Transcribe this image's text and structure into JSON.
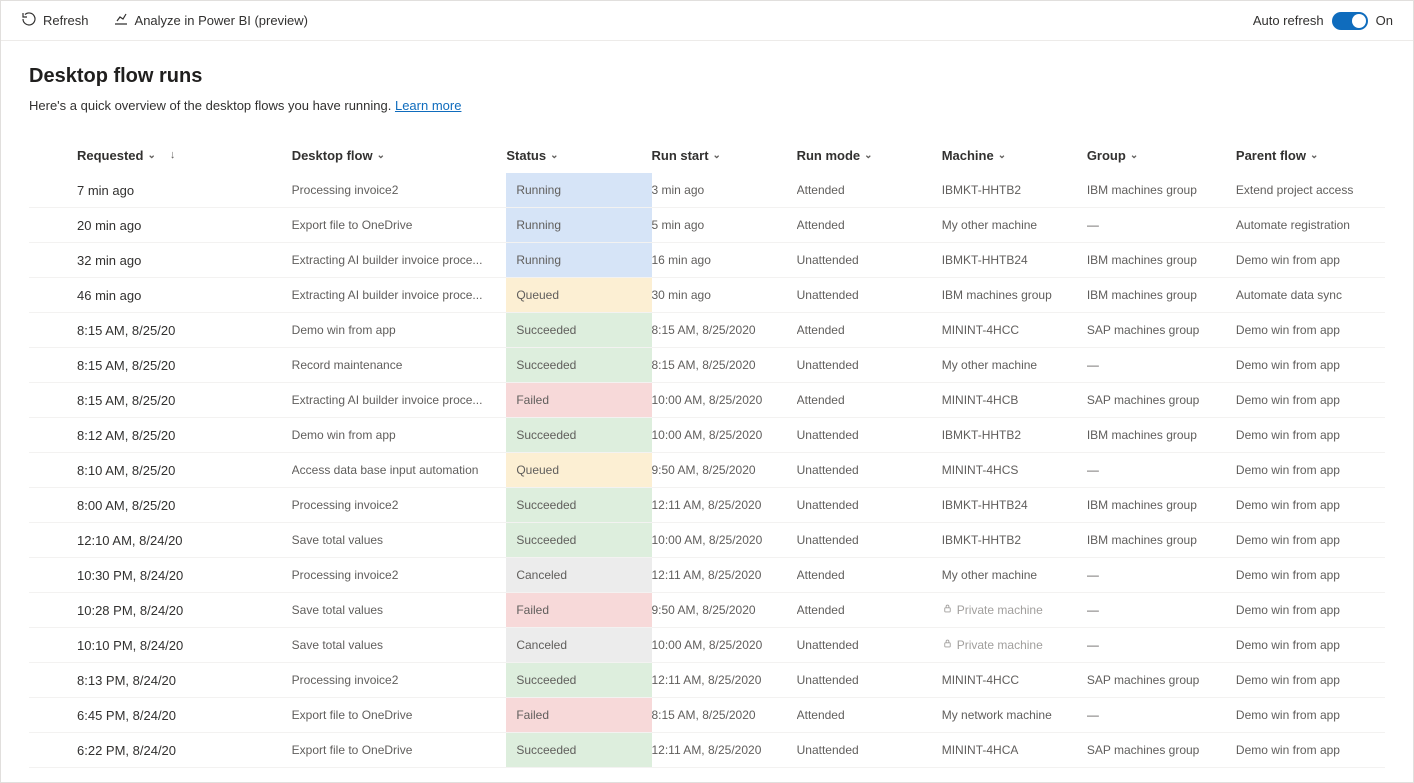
{
  "toolbar": {
    "refresh_label": "Refresh",
    "analyze_label": "Analyze in Power BI (preview)",
    "auto_refresh_label": "Auto refresh",
    "auto_refresh_state": "On"
  },
  "page": {
    "title": "Desktop flow runs",
    "subtitle": "Here's a quick overview of the desktop flows you have running.",
    "learn_more": "Learn more"
  },
  "columns": {
    "requested": "Requested",
    "desktop_flow": "Desktop flow",
    "status": "Status",
    "run_start": "Run start",
    "run_mode": "Run mode",
    "machine": "Machine",
    "group": "Group",
    "parent_flow": "Parent flow"
  },
  "rows": [
    {
      "requested": "7 min ago",
      "flow": "Processing invoice2",
      "status": "Running",
      "start": "3 min ago",
      "mode": "Attended",
      "machine": "IBMKT-HHTB2",
      "group": "IBM machines group",
      "parent": "Extend project access"
    },
    {
      "requested": "20 min ago",
      "flow": "Export file to OneDrive",
      "status": "Running",
      "start": "5 min ago",
      "mode": "Attended",
      "machine": "My other machine",
      "group": "—",
      "parent": "Automate registration"
    },
    {
      "requested": "32 min ago",
      "flow": "Extracting AI builder invoice proce...",
      "status": "Running",
      "start": "16 min ago",
      "mode": "Unattended",
      "machine": "IBMKT-HHTB24",
      "group": "IBM machines group",
      "parent": "Demo win from app"
    },
    {
      "requested": "46 min ago",
      "flow": "Extracting AI builder invoice proce...",
      "status": "Queued",
      "start": "30 min ago",
      "mode": "Unattended",
      "machine": "IBM machines group",
      "group": "IBM machines group",
      "parent": "Automate data sync"
    },
    {
      "requested": "8:15 AM, 8/25/20",
      "flow": "Demo win from app",
      "status": "Succeeded",
      "start": "8:15 AM, 8/25/2020",
      "mode": "Attended",
      "machine": "MININT-4HCC",
      "group": "SAP machines group",
      "parent": "Demo win from app"
    },
    {
      "requested": "8:15 AM, 8/25/20",
      "flow": "Record maintenance",
      "status": "Succeeded",
      "start": "8:15 AM, 8/25/2020",
      "mode": "Unattended",
      "machine": "My other machine",
      "group": "—",
      "parent": "Demo win from app"
    },
    {
      "requested": "8:15 AM, 8/25/20",
      "flow": "Extracting AI builder invoice proce...",
      "status": "Failed",
      "start": "10:00 AM, 8/25/2020",
      "mode": "Attended",
      "machine": "MININT-4HCB",
      "group": "SAP machines group",
      "parent": "Demo win from app"
    },
    {
      "requested": "8:12 AM, 8/25/20",
      "flow": "Demo win from app",
      "status": "Succeeded",
      "start": "10:00 AM, 8/25/2020",
      "mode": "Unattended",
      "machine": "IBMKT-HHTB2",
      "group": "IBM machines group",
      "parent": "Demo win from app"
    },
    {
      "requested": "8:10 AM, 8/25/20",
      "flow": "Access data base input automation",
      "status": "Queued",
      "start": "9:50 AM, 8/25/2020",
      "mode": "Unattended",
      "machine": "MININT-4HCS",
      "group": "—",
      "parent": "Demo win from app"
    },
    {
      "requested": "8:00 AM, 8/25/20",
      "flow": "Processing invoice2",
      "status": "Succeeded",
      "start": "12:11 AM, 8/25/2020",
      "mode": "Unattended",
      "machine": "IBMKT-HHTB24",
      "group": "IBM machines group",
      "parent": "Demo win from app"
    },
    {
      "requested": "12:10 AM, 8/24/20",
      "flow": "Save total values",
      "status": "Succeeded",
      "start": "10:00 AM, 8/25/2020",
      "mode": "Unattended",
      "machine": "IBMKT-HHTB2",
      "group": "IBM machines group",
      "parent": "Demo win from app"
    },
    {
      "requested": "10:30 PM, 8/24/20",
      "flow": "Processing invoice2",
      "status": "Canceled",
      "start": "12:11 AM, 8/25/2020",
      "mode": "Attended",
      "machine": "My other machine",
      "group": "—",
      "parent": "Demo win from app"
    },
    {
      "requested": "10:28 PM, 8/24/20",
      "flow": "Save total values",
      "status": "Failed",
      "start": "9:50 AM, 8/25/2020",
      "mode": "Attended",
      "machine": "Private machine",
      "machine_private": true,
      "group": "—",
      "parent": "Demo win from app"
    },
    {
      "requested": "10:10 PM, 8/24/20",
      "flow": "Save total values",
      "status": "Canceled",
      "start": "10:00 AM, 8/25/2020",
      "mode": "Unattended",
      "machine": "Private machine",
      "machine_private": true,
      "group": "—",
      "parent": "Demo win from app"
    },
    {
      "requested": "8:13 PM, 8/24/20",
      "flow": "Processing invoice2",
      "status": "Succeeded",
      "start": "12:11 AM, 8/25/2020",
      "mode": "Unattended",
      "machine": "MININT-4HCC",
      "group": "SAP machines group",
      "parent": "Demo win from app"
    },
    {
      "requested": "6:45 PM, 8/24/20",
      "flow": "Export file to OneDrive",
      "status": "Failed",
      "start": "8:15 AM, 8/25/2020",
      "mode": "Attended",
      "machine": "My network machine",
      "group": "—",
      "parent": "Demo win from app"
    },
    {
      "requested": "6:22 PM, 8/24/20",
      "flow": "Export file to OneDrive",
      "status": "Succeeded",
      "start": "12:11 AM, 8/25/2020",
      "mode": "Unattended",
      "machine": "MININT-4HCA",
      "group": "SAP machines group",
      "parent": "Demo win from app"
    }
  ]
}
